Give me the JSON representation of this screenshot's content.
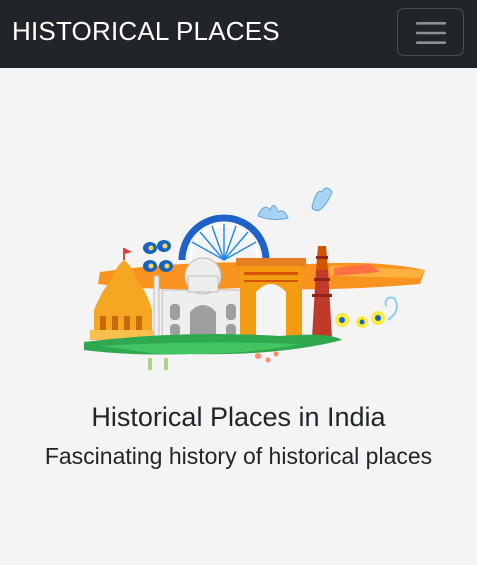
{
  "navbar": {
    "brand": "HISTORICAL PLACES",
    "toggler_icon": "hamburger-menu-icon"
  },
  "hero": {
    "image_icon": "india-monuments-illustration",
    "title": "Historical Places in India",
    "subtitle": "Fascinating history of historical places"
  },
  "colors": {
    "navbar_bg": "#212529",
    "page_bg": "#f4f4f4",
    "saffron": "#f7931e",
    "green": "#2fa84f",
    "chakra_blue": "#1e88e5"
  }
}
